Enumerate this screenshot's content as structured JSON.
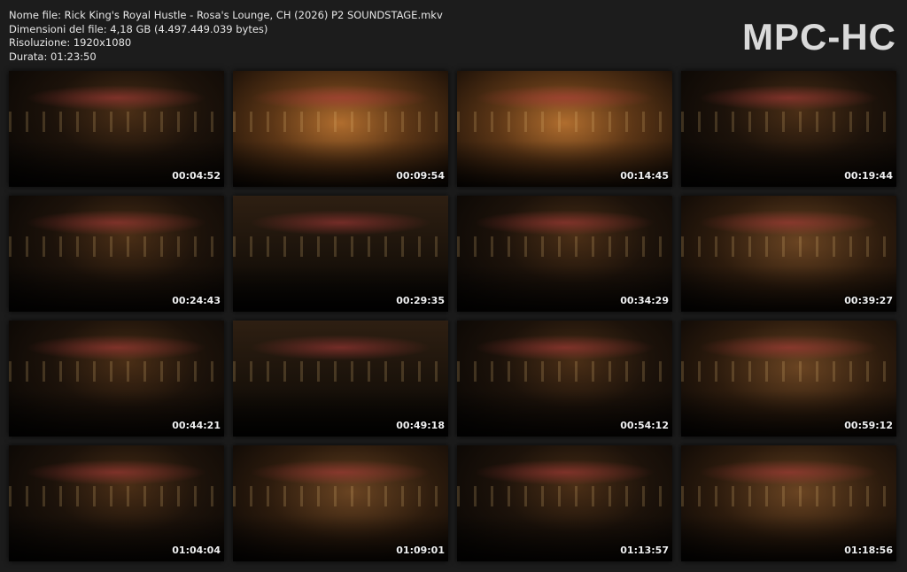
{
  "info": {
    "file_name": "Nome file: Rick King's Royal Hustle - Rosa's Lounge, CH (2026) P2 SOUNDSTAGE.mkv",
    "file_size": "Dimensioni del file: 4,18 GB (4.497.449.039 bytes)",
    "resolution": "Risoluzione: 1920x1080",
    "duration": "Durata: 01:23:50"
  },
  "logo": "MPC-HC",
  "thumbnails": [
    {
      "time": "00:04:52",
      "style": "dark"
    },
    {
      "time": "00:09:54",
      "style": "warm"
    },
    {
      "time": "00:14:45",
      "style": "warm"
    },
    {
      "time": "00:19:44",
      "style": "dark"
    },
    {
      "time": "00:24:43",
      "style": "dark"
    },
    {
      "time": "00:29:35",
      "style": "crowd"
    },
    {
      "time": "00:34:29",
      "style": "dark"
    },
    {
      "time": "00:39:27",
      "style": "mid"
    },
    {
      "time": "00:44:21",
      "style": "dark"
    },
    {
      "time": "00:49:18",
      "style": "crowd"
    },
    {
      "time": "00:54:12",
      "style": "dark"
    },
    {
      "time": "00:59:12",
      "style": "mid"
    },
    {
      "time": "01:04:04",
      "style": "dark"
    },
    {
      "time": "01:09:01",
      "style": "mid"
    },
    {
      "time": "01:13:57",
      "style": "dark"
    },
    {
      "time": "01:18:56",
      "style": "mid"
    }
  ]
}
